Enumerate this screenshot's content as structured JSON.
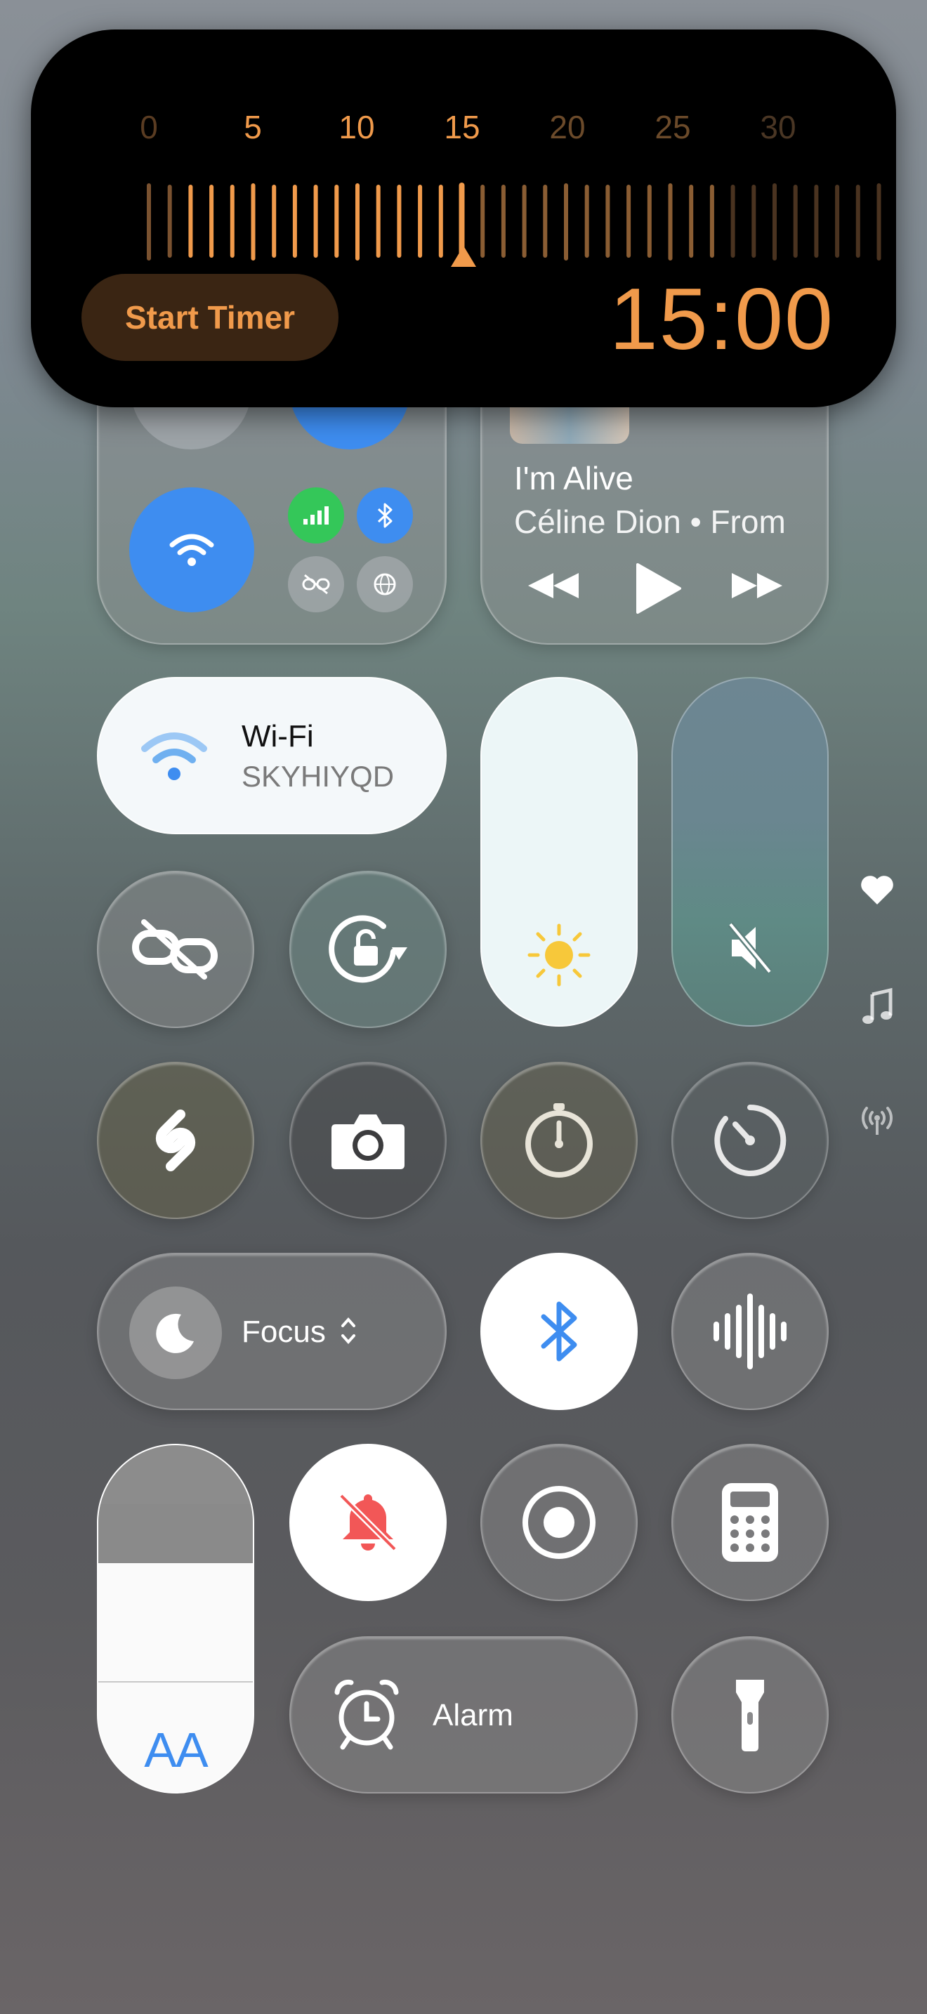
{
  "timer": {
    "ruler_labels": [
      "0",
      "5",
      "10",
      "15",
      "20",
      "25",
      "30"
    ],
    "selected_minutes": 15,
    "start_label": "Start Timer",
    "readout": "15:00",
    "accent_color": "#f09a4b"
  },
  "connectivity": {
    "wifi_active": true,
    "cellular_active": true,
    "bluetooth_active": true,
    "icons": [
      "airplane-icon",
      "airdrop-icon",
      "wifi-icon",
      "cellular-icon",
      "bluetooth-icon",
      "hotspot-icon",
      "vpn-icon"
    ]
  },
  "now_playing": {
    "title": "I'm Alive",
    "artist": "Céline Dion • From",
    "controls": [
      "rewind-icon",
      "play-icon",
      "fast-forward-icon"
    ]
  },
  "wifi_tile": {
    "label": "Wi-Fi",
    "network": "SKYHIYQD"
  },
  "sliders": {
    "brightness_level": 1.0,
    "volume_level": 0.0,
    "volume_muted": true
  },
  "row_toggles": [
    "screen-mirroring-icon",
    "orientation-lock-icon",
    "shazam-icon",
    "camera-icon",
    "stopwatch-icon",
    "timer-icon"
  ],
  "focus": {
    "label": "Focus"
  },
  "bluetooth_tile_active": true,
  "silent_mode_active": true,
  "alarm": {
    "label": "Alarm"
  },
  "text_size": {
    "label": "AA"
  },
  "side_indicators": [
    "heart-icon",
    "music-note-icon",
    "antenna-icon"
  ],
  "colors": {
    "blue": "#3e8df0",
    "green": "#34c759",
    "red": "#f25757",
    "sun": "#f7c83a"
  }
}
